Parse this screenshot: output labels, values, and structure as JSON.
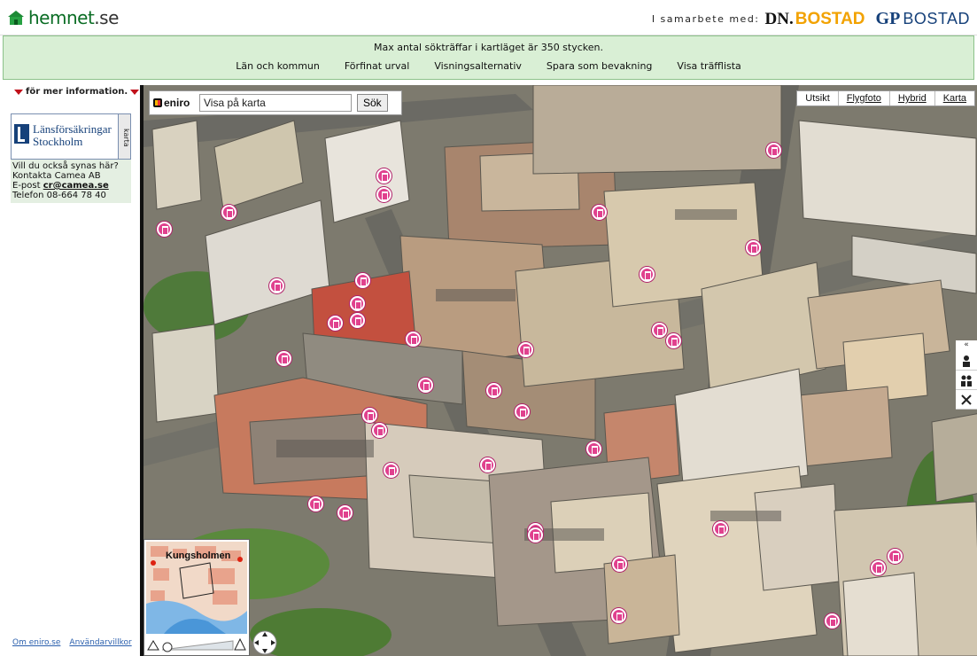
{
  "header": {
    "logo_text": "hemnet",
    "logo_suffix": ".se",
    "partners_label": "I samarbete med:",
    "dn_logo": "DN.",
    "dn_bostad": "BOSTAD",
    "gp_logo": "GP",
    "gp_bostad": "BOSTAD"
  },
  "filterbar": {
    "notice": "Max antal sökträffar i kartläget är 350 stycken.",
    "nav": [
      "Län och kommun",
      "Förfinat urval",
      "Visningsalternativ",
      "Spara som bevakning",
      "Visa träfflista"
    ]
  },
  "sidebar": {
    "more_info": "för mer information.",
    "ad_name": "Länsförsäkringar Stockholm",
    "ad_tab": "karta",
    "contact_line1": "Vill du också synas här?",
    "contact_line2": "Kontakta Camea AB",
    "contact_email_label": "E-post",
    "contact_email": "cr@camea.se",
    "contact_phone": "Telefon 08-664 78 40",
    "footer_links": [
      "Om eniro.se",
      "Användarvillkor"
    ]
  },
  "map": {
    "search": {
      "brand": "eniro",
      "placeholder": "Visa på karta",
      "value": "Visa på karta",
      "button": "Sök"
    },
    "view_tabs": [
      "Utsikt",
      "Flygfoto",
      "Hybrid",
      "Karta"
    ],
    "active_view": "Utsikt",
    "minimap_label": "Kungsholmen",
    "collapse_glyph": "«",
    "tools": [
      "person-icon",
      "people-icon",
      "tools-icon"
    ],
    "marker_color": "#e0418e",
    "listing_marker_count": 36
  }
}
